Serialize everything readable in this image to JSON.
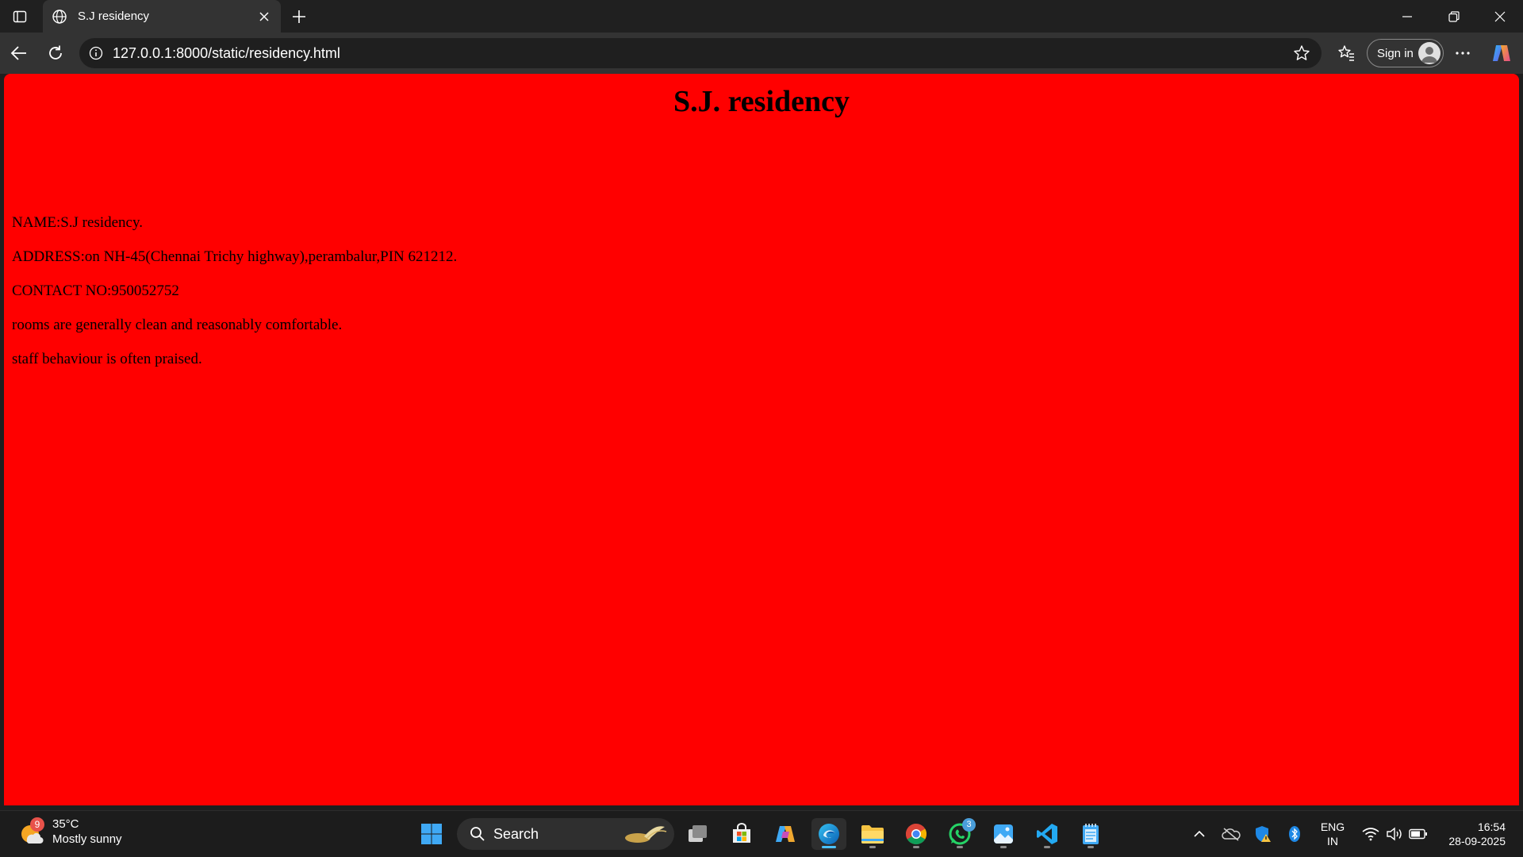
{
  "browser": {
    "tab_title": "S.J residency",
    "url": "127.0.0.1:8000/static/residency.html",
    "signin_label": "Sign in"
  },
  "page": {
    "background_color": "#ff0000",
    "heading": "S.J. residency",
    "paragraphs": [
      "NAME:S.J residency.",
      "ADDRESS:on NH-45(Chennai Trichy highway),perambalur,PIN 621212.",
      "CONTACT NO:950052752",
      "rooms are generally clean and reasonably comfortable.",
      "staff behaviour is often praised."
    ]
  },
  "taskbar": {
    "weather": {
      "badge": "9",
      "temperature": "35°C",
      "condition": "Mostly sunny"
    },
    "search_label": "Search",
    "whatsapp_badge": "3",
    "language_line1": "ENG",
    "language_line2": "IN",
    "time": "16:54",
    "date": "28-09-2025",
    "apps": [
      "start",
      "search",
      "task-view",
      "microsoft-store",
      "copilot",
      "edge",
      "file-explorer",
      "chrome",
      "whatsapp",
      "photos",
      "vscode",
      "notepad"
    ]
  }
}
